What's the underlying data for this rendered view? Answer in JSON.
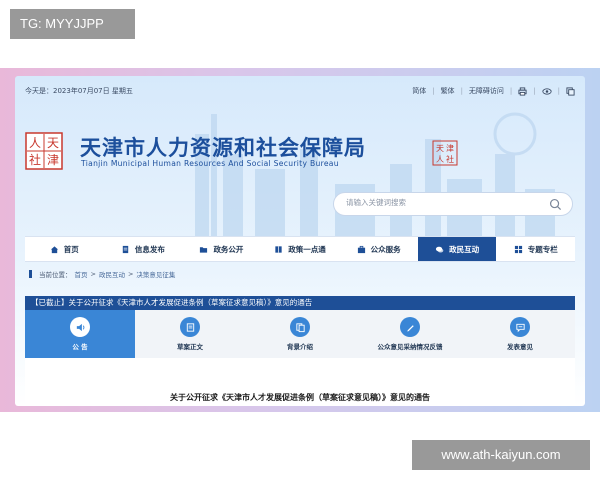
{
  "tag": {
    "text": "TG: MYYJJPP"
  },
  "watermark": {
    "text": "www.ath-kaiyun.com"
  },
  "colors": {
    "brand": "#1e4f97",
    "accent": "#3a86d6",
    "frame_left": "#e9b8d9",
    "frame_right": "#bcd2f2",
    "seal": "#c8382e"
  },
  "topbar": {
    "date": "今天是：2023年07月07日 星期五",
    "links": [
      "简体",
      "繁体",
      "无障碍访问"
    ],
    "icons": [
      "print-icon",
      "eye-icon",
      "copy-icon"
    ]
  },
  "header": {
    "logo_chars": [
      "人",
      "天",
      "社",
      "津"
    ],
    "title": "天津市人力资源和社会保障局",
    "subtitle": "Tianjin Municipal Human Resources And Social Security Bureau",
    "seal_chars": [
      "天",
      "津",
      "人",
      "社"
    ]
  },
  "search": {
    "placeholder": "请输入关键词搜索",
    "icon": "search-icon"
  },
  "nav": {
    "items": [
      {
        "label": "首页",
        "icon": "home-icon"
      },
      {
        "label": "信息发布",
        "icon": "document-icon"
      },
      {
        "label": "政务公开",
        "icon": "folder-icon"
      },
      {
        "label": "政策一点通",
        "icon": "book-icon"
      },
      {
        "label": "公众服务",
        "icon": "briefcase-icon"
      },
      {
        "label": "政民互动",
        "icon": "chat-icon"
      },
      {
        "label": "专题专栏",
        "icon": "grid-icon"
      }
    ],
    "active_index": 5
  },
  "breadcrumb": {
    "label": "当前位置：",
    "items": [
      "首页",
      "政民互动",
      "决策意见征集"
    ],
    "separator": ">"
  },
  "notice": {
    "text": "【已截止】关于公开征求《天津市人才发展促进条例（草案征求意见稿）》意见的通告"
  },
  "tabs": {
    "items": [
      {
        "label": "公 告",
        "icon": "speaker-icon"
      },
      {
        "label": "草案正文",
        "icon": "list-icon"
      },
      {
        "label": "背景介绍",
        "icon": "files-icon"
      },
      {
        "label": "公众意见采纳情况反馈",
        "icon": "pen-icon"
      },
      {
        "label": "发表意见",
        "icon": "comment-icon"
      }
    ],
    "active_index": 0
  },
  "content": {
    "title": "关于公开征求《天津市人才发展促进条例（草案征求意见稿）》意见的通告"
  }
}
